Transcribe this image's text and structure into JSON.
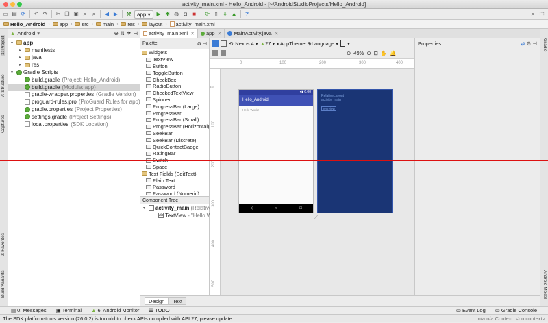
{
  "window": {
    "title": "activity_main.xml - Hello_Android - [~/AndroidStudioProjects/Hello_Android]"
  },
  "toolbar": {
    "run_config": "app"
  },
  "breadcrumbs": [
    "Hello_Android",
    "app",
    "src",
    "main",
    "res",
    "layout",
    "activity_main.xml"
  ],
  "left_strip": {
    "tabs": [
      "1: Project",
      "7: Structure",
      "Captures",
      "2: Favorites",
      "Build Variants"
    ]
  },
  "right_strip": {
    "tabs": [
      "Gradle",
      "Android Model"
    ]
  },
  "project_panel": {
    "view": "Android",
    "items": [
      {
        "label": "app",
        "muted": "",
        "level": 0,
        "toggle": "▾",
        "icon": "folder",
        "bold": true
      },
      {
        "label": "manifests",
        "muted": "",
        "level": 1,
        "toggle": "▸",
        "icon": "folder"
      },
      {
        "label": "java",
        "muted": "",
        "level": 1,
        "toggle": "▸",
        "icon": "folder"
      },
      {
        "label": "res",
        "muted": "",
        "level": 1,
        "toggle": "▸",
        "icon": "folder"
      },
      {
        "label": "Gradle Scripts",
        "muted": "",
        "level": 0,
        "toggle": "▾",
        "icon": "gradle"
      },
      {
        "label": "build.gradle",
        "muted": "(Project: Hello_Android)",
        "level": 1,
        "toggle": "",
        "icon": "gradle"
      },
      {
        "label": "build.gradle",
        "muted": "(Module: app)",
        "level": 1,
        "toggle": "",
        "icon": "gradle",
        "selected": true
      },
      {
        "label": "gradle-wrapper.properties",
        "muted": "(Gradle Version)",
        "level": 1,
        "toggle": "",
        "icon": "file"
      },
      {
        "label": "proguard-rules.pro",
        "muted": "(ProGuard Rules for app)",
        "level": 1,
        "toggle": "",
        "icon": "file"
      },
      {
        "label": "gradle.properties",
        "muted": "(Project Properties)",
        "level": 1,
        "toggle": "",
        "icon": "gradle"
      },
      {
        "label": "settings.gradle",
        "muted": "(Project Settings)",
        "level": 1,
        "toggle": "",
        "icon": "gradle"
      },
      {
        "label": "local.properties",
        "muted": "(SDK Location)",
        "level": 1,
        "toggle": "",
        "icon": "file"
      }
    ]
  },
  "editor_tabs": [
    {
      "label": "activity_main.xml",
      "active": true
    },
    {
      "label": "app",
      "active": false
    },
    {
      "label": "MainActivity.java",
      "active": false
    }
  ],
  "palette": {
    "title": "Palette",
    "items": [
      {
        "label": "Widgets",
        "cat": true
      },
      {
        "label": "TextView"
      },
      {
        "label": "Button"
      },
      {
        "label": "ToggleButton"
      },
      {
        "label": "CheckBox"
      },
      {
        "label": "RadioButton"
      },
      {
        "label": "CheckedTextView"
      },
      {
        "label": "Spinner"
      },
      {
        "label": "ProgressBar (Large)"
      },
      {
        "label": "ProgressBar"
      },
      {
        "label": "ProgressBar (Small)"
      },
      {
        "label": "ProgressBar (Horizontal)"
      },
      {
        "label": "SeekBar"
      },
      {
        "label": "SeekBar (Discrete)"
      },
      {
        "label": "QuickContactBadge"
      },
      {
        "label": "RatingBar"
      },
      {
        "label": "Switch"
      },
      {
        "label": "Space"
      },
      {
        "label": "Text Fields (EditText)",
        "cat": true
      },
      {
        "label": "Plain Text"
      },
      {
        "label": "Password"
      },
      {
        "label": "Password (Numeric)"
      }
    ]
  },
  "component_tree": {
    "title": "Component Tree",
    "root": "activity_main",
    "root_type": "(RelativeLayout)",
    "child": "TextView",
    "child_text": "- \"Hello World!\""
  },
  "design_toolbar": {
    "device": "Nexus 4",
    "api": "27",
    "theme": "AppTheme",
    "language": "Language",
    "zoom": "49%"
  },
  "canvas": {
    "ruler_x": [
      "0",
      "100",
      "200",
      "300",
      "400"
    ],
    "ruler_y": [
      "0",
      "100",
      "200",
      "300",
      "400",
      "500"
    ],
    "app_title": "Hello_Android",
    "hello_text": "Hello World!",
    "status_time": "6:00",
    "blueprint_layout": "RelativeLayout",
    "blueprint_id": "activity_main",
    "blueprint_text": "TextView"
  },
  "properties": {
    "title": "Properties"
  },
  "bottom_tabs": [
    {
      "label": "Design",
      "active": true
    },
    {
      "label": "Text",
      "active": false
    }
  ],
  "tool_windows": [
    "0: Messages",
    "Terminal",
    "6: Android Monitor",
    "TODO"
  ],
  "tool_windows_right": [
    "Event Log",
    "Gradle Console"
  ],
  "status": {
    "message": "The SDK platform-tools version (26.0.2) is too old  to check APIs compiled with API 27; please update",
    "right": "n/a    n/a   Context: <no context>"
  }
}
